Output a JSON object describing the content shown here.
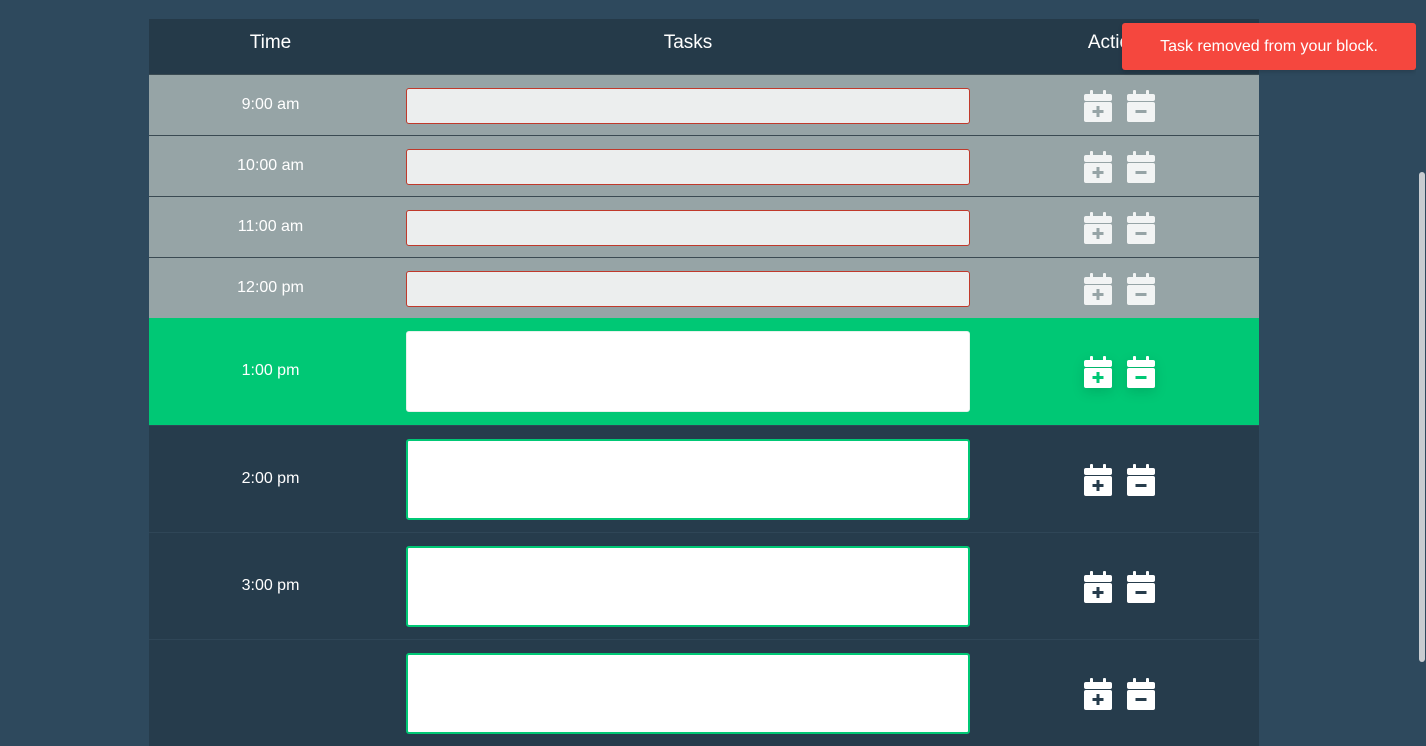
{
  "header": {
    "time_label": "Time",
    "tasks_label": "Tasks",
    "actions_label": "Actions"
  },
  "toast": {
    "message": "Task removed from your block."
  },
  "colors": {
    "past_block": "#96a4a6",
    "present_block": "#00c875",
    "future_block": "#263c4c",
    "toast": "#f5473e",
    "page_background": "#2e495d"
  },
  "hours": [
    {
      "label": "9:00 am",
      "state": "past",
      "task": ""
    },
    {
      "label": "10:00 am",
      "state": "past",
      "task": ""
    },
    {
      "label": "11:00 am",
      "state": "past",
      "task": ""
    },
    {
      "label": "12:00 pm",
      "state": "past",
      "task": ""
    },
    {
      "label": "1:00 pm",
      "state": "present",
      "task": ""
    },
    {
      "label": "2:00 pm",
      "state": "future",
      "task": ""
    },
    {
      "label": "3:00 pm",
      "state": "future",
      "task": ""
    },
    {
      "label": "",
      "state": "future",
      "task": ""
    }
  ],
  "icons": {
    "add": "calendar-plus-icon",
    "remove": "calendar-minus-icon"
  }
}
